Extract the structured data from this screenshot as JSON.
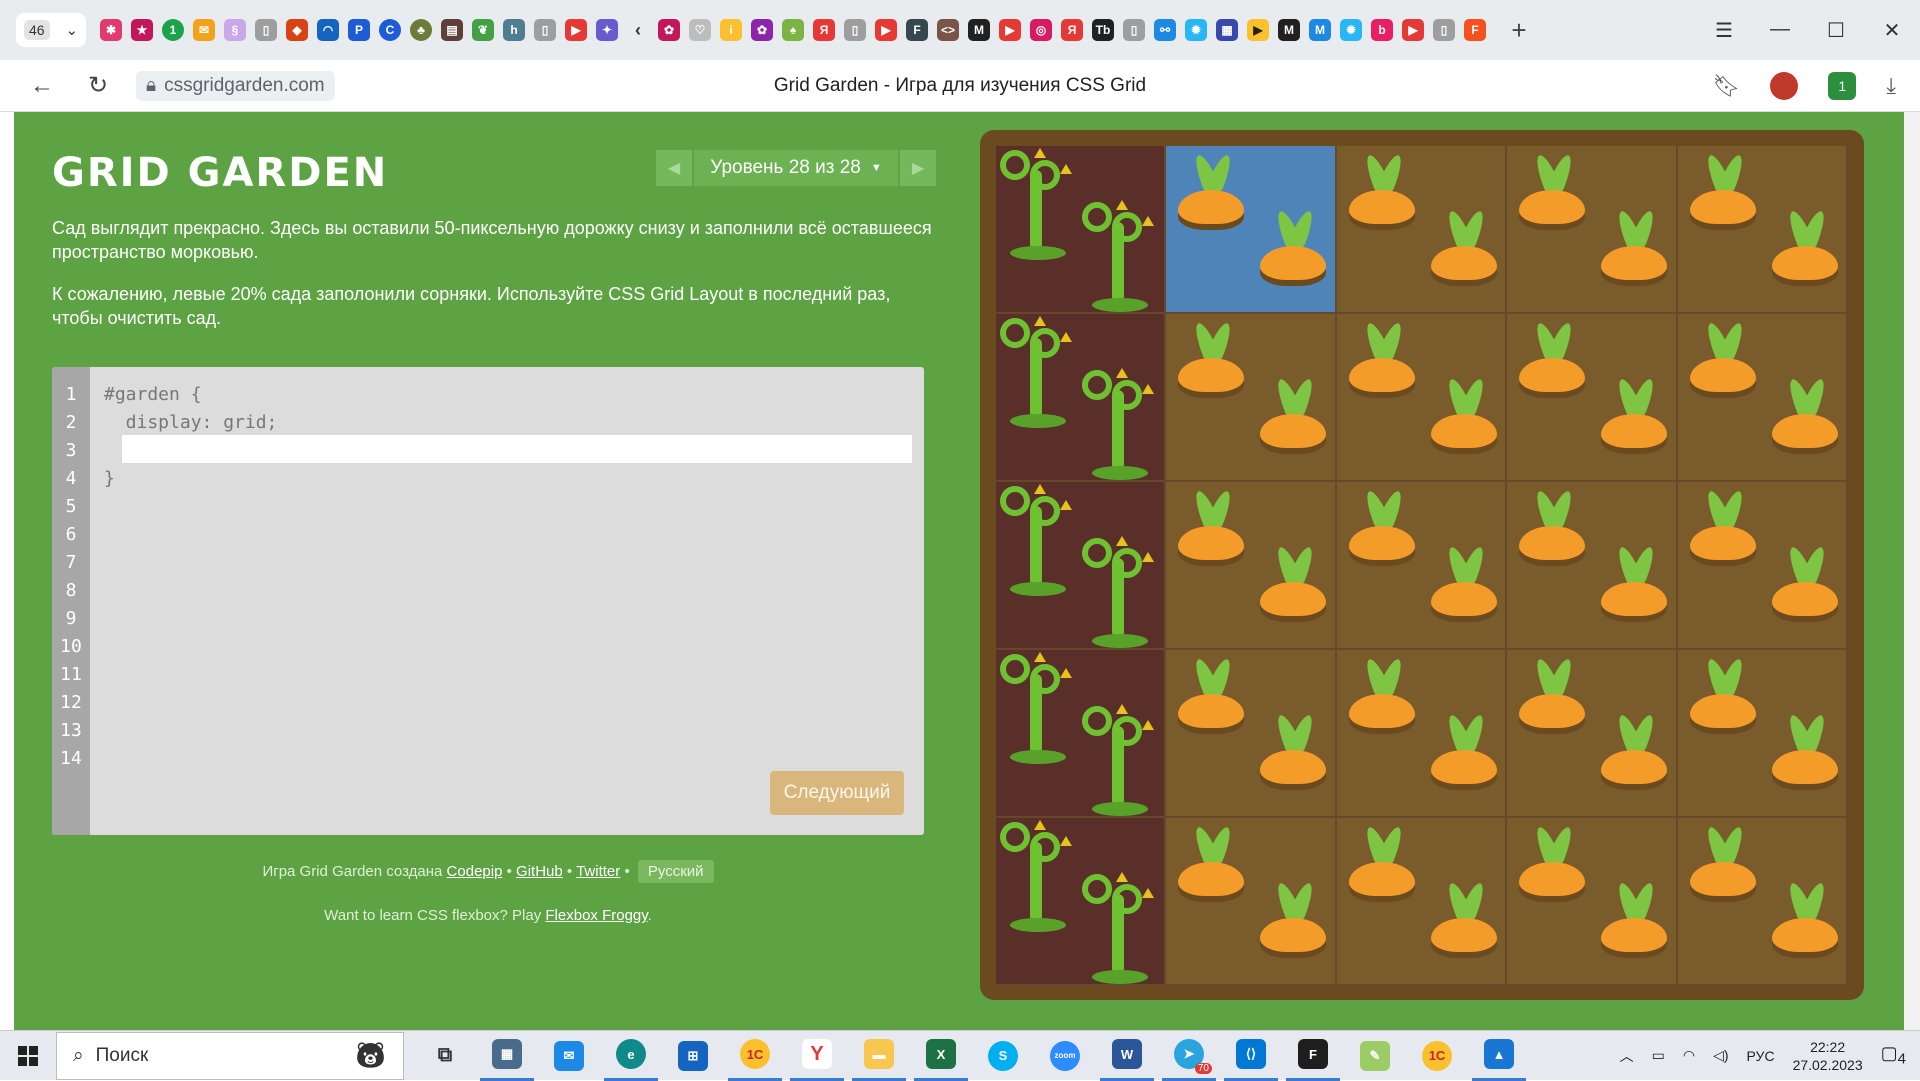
{
  "browser": {
    "tab_count": "46",
    "new_tab_symbol": "+",
    "url": "cssgridgarden.com",
    "page_title": "Grid Garden - Игра для изучения CSS Grid",
    "window_controls": [
      "☰",
      "—",
      "☐",
      "✕"
    ],
    "extension_badge": "1"
  },
  "game": {
    "title": "GRID GARDEN",
    "level_label": "Уровень 28 из 28",
    "paragraph_1": "Сад выглядит прекрасно. Здесь вы оставили 50-пиксельную дорожку снизу и заполнили всё оставшееся пространство морковью.",
    "paragraph_2": "К сожалению, левые 20% сада заполонили сорняки. Используйте CSS Grid Layout в последний раз, чтобы очистить сад.",
    "line_numbers": [
      "1",
      "2",
      "3",
      "4",
      "5",
      "6",
      "7",
      "8",
      "9",
      "10",
      "11",
      "12",
      "13",
      "14"
    ],
    "code_line_1": "#garden {",
    "code_line_2": "  display: grid;",
    "code_line_4": "}",
    "code_input_value": "",
    "next_button": "Следующий",
    "credits_prefix": "Игра Grid Garden создана",
    "credit_links": [
      "Codepip",
      "GitHub",
      "Twitter"
    ],
    "credit_separator": "•",
    "language_button": "Русский",
    "flexbox_prefix": "Want to learn CSS flexbox? Play",
    "flexbox_link": "Flexbox Froggy",
    "flexbox_suffix": "."
  },
  "garden": {
    "columns": 5,
    "rows_of_carrots": 5,
    "weed_column": 1,
    "water_cell": "row 1, column 2"
  },
  "taskbar": {
    "search_placeholder": "Поиск",
    "language": "РУС",
    "time": "22:22",
    "date": "27.02.2023",
    "notification_count": "4",
    "telegram_badge": "70"
  },
  "colors": {
    "page_green": "#5da344",
    "soil": "#7a5b2b",
    "weeds_cell": "#5a2f2a",
    "water_cell": "#4f84b8",
    "carrot": "#f39c2a",
    "leaf": "#7dc542",
    "next_button": "#d9b67c"
  }
}
